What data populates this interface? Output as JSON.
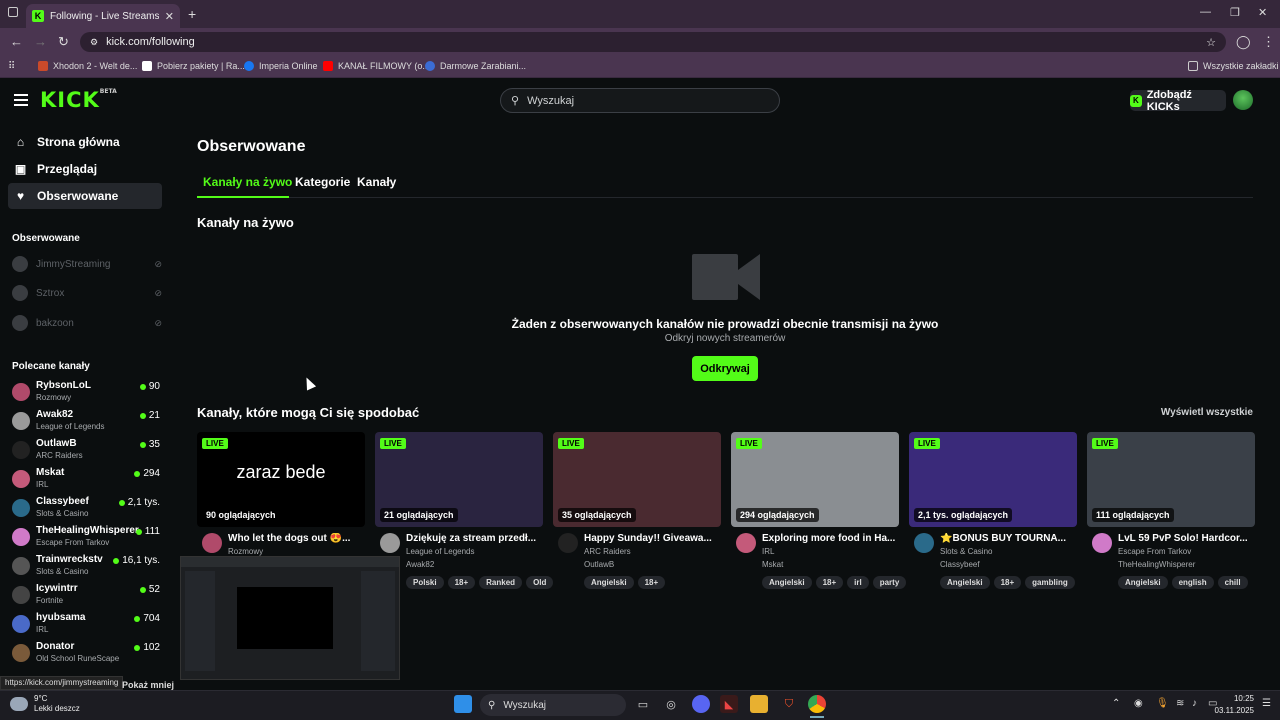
{
  "browser": {
    "tab_title": "Following - Live Streams on Kick",
    "url": "kick.com/following",
    "bookmarks": [
      {
        "label": "Xhodon 2 - Welt de...",
        "color": "#c94a2a"
      },
      {
        "label": "Pobierz pakiety | Ra...",
        "color": "#ffffff"
      },
      {
        "label": "Imperia Online",
        "color": "#1877f2"
      },
      {
        "label": "KANAŁ FILMOWY (o...",
        "color": "#ff0000"
      },
      {
        "label": "Darmowe Zarabiani...",
        "color": "#3b6cd4"
      }
    ],
    "all_bookmarks": "Wszystkie zakładki"
  },
  "header": {
    "logo": "KICK",
    "beta": "BETA",
    "search_placeholder": "Wyszukaj",
    "get_kicks": "Zdobądź KICKs"
  },
  "sidebar": {
    "nav": [
      {
        "label": "Strona główna",
        "icon": "home-icon"
      },
      {
        "label": "Przeglądaj",
        "icon": "browse-icon"
      },
      {
        "label": "Obserwowane",
        "icon": "heart-icon"
      }
    ],
    "following_heading": "Obserwowane",
    "following": [
      {
        "name": "JimmyStreaming"
      },
      {
        "name": "Sztrox"
      },
      {
        "name": "bakzoon"
      }
    ],
    "recommended_heading": "Polecane kanały",
    "recommended": [
      {
        "name": "RybsonLoL",
        "category": "Rozmowy",
        "viewers": "90",
        "color": "#b04a6a"
      },
      {
        "name": "Awak82",
        "category": "League of Legends",
        "viewers": "21",
        "color": "#9a9a9a"
      },
      {
        "name": "OutlawB",
        "category": "ARC Raiders",
        "viewers": "35",
        "color": "#222222"
      },
      {
        "name": "Mskat",
        "category": "IRL",
        "viewers": "294",
        "color": "#c45a7a"
      },
      {
        "name": "Classybeef",
        "category": "Slots & Casino",
        "viewers": "2,1 tys.",
        "color": "#2a6a8a"
      },
      {
        "name": "TheHealingWhisperer",
        "category": "Escape From Tarkov",
        "viewers": "111",
        "color": "#d07ac8"
      },
      {
        "name": "Trainwreckstv",
        "category": "Slots & Casino",
        "viewers": "16,1 tys.",
        "color": "#555555"
      },
      {
        "name": "Icywintrr",
        "category": "Fortnite",
        "viewers": "52",
        "color": "#444444"
      },
      {
        "name": "hyubsama",
        "category": "IRL",
        "viewers": "704",
        "color": "#4a6ac8"
      },
      {
        "name": "Donator",
        "category": "Old School RuneScape",
        "viewers": "102",
        "color": "#7a5a3a"
      }
    ],
    "show_more": "Pokaż mniej"
  },
  "main": {
    "title": "Obserwowane",
    "tabs": [
      "Kanały na żywo",
      "Kategorie",
      "Kanały"
    ],
    "live_heading": "Kanały na żywo",
    "empty_title": "Żaden z obserwowanych kanałów nie prowadzi obecnie transmisji na żywo",
    "empty_sub": "Odkryj nowych streamerów",
    "discover_button": "Odkrywaj",
    "suggest_heading": "Kanały, które mogą Ci się spodobać",
    "view_all": "Wyświetl wszystkie",
    "cards": [
      {
        "live": "LIVE",
        "thumb_text": "zaraz bede",
        "viewers": "90 oglądających",
        "title": "Who let the dogs out 😍...",
        "category": "Rozmowy",
        "channel": "RybsonLoL",
        "tags": [],
        "bg": "#000000",
        "av": "#b04a6a"
      },
      {
        "live": "LIVE",
        "thumb_text": "",
        "viewers": "21 oglądających",
        "title": "Dziękuję za stream przedł...",
        "category": "League of Legends",
        "channel": "Awak82",
        "tags": [
          "Polski",
          "18+",
          "Ranked",
          "Old"
        ],
        "bg": "#2a2440",
        "av": "#9a9a9a"
      },
      {
        "live": "LIVE",
        "thumb_text": "",
        "viewers": "35 oglądających",
        "title": "Happy Sunday!! Giveawa...",
        "category": "ARC Raiders",
        "channel": "OutlawB",
        "tags": [
          "Angielski",
          "18+"
        ],
        "bg": "#4a2a30",
        "av": "#222222"
      },
      {
        "live": "LIVE",
        "thumb_text": "",
        "viewers": "294 oglądających",
        "title": "Exploring more food in Ha...",
        "category": "IRL",
        "channel": "Mskat",
        "tags": [
          "Angielski",
          "18+",
          "irl",
          "party"
        ],
        "bg": "#8a8e92",
        "av": "#c45a7a"
      },
      {
        "live": "LIVE",
        "thumb_text": "",
        "viewers": "2,1 tys. oglądających",
        "title": "⭐BONUS BUY TOURNA...",
        "category": "Slots & Casino",
        "channel": "Classybeef",
        "tags": [
          "Angielski",
          "18+",
          "gambling"
        ],
        "bg": "#3a2a7a",
        "av": "#2a6a8a"
      },
      {
        "live": "LIVE",
        "thumb_text": "",
        "viewers": "111 oglądających",
        "title": "LvL 59 PvP Solo! Hardcor...",
        "category": "Escape From Tarkov",
        "channel": "TheHealingWhisperer",
        "tags": [
          "Angielski",
          "english",
          "chill"
        ],
        "bg": "#3a4048",
        "av": "#d07ac8"
      }
    ]
  },
  "status_url": "https://kick.com/jimmystreaming",
  "taskbar": {
    "temp": "9°C",
    "weather": "Lekki deszcz",
    "search": "Wyszukaj",
    "time": "10:25",
    "date": "03.11.2025"
  }
}
